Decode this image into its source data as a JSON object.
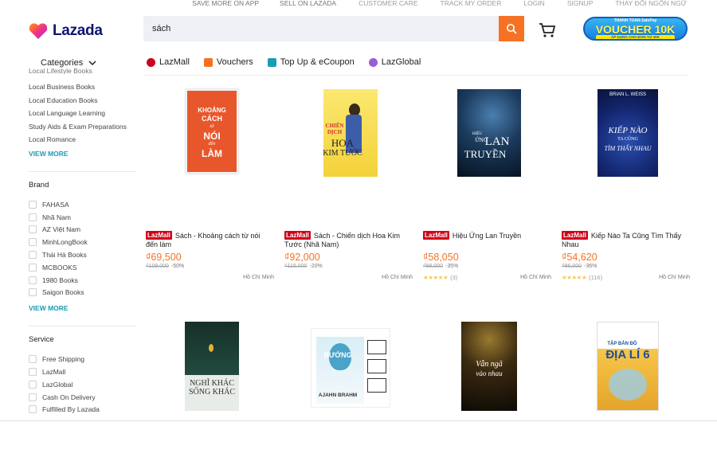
{
  "topbar": {
    "links": [
      "SAVE MORE ON APP",
      "SELL ON LAZADA",
      "CUSTOMER CARE",
      "TRACK MY ORDER",
      "LOGIN",
      "SIGNUP",
      "THAY ĐỔI NGÔN NGỮ"
    ]
  },
  "header": {
    "logo_text": "Lazada",
    "search_value": "sách",
    "voucher": {
      "top": "THANH TOÁN ZaloPay",
      "main": "VOUCHER 10K",
      "bottom": "ÁP DỤNG CHO ĐƠN TỪ 30K"
    }
  },
  "nav": {
    "categories_label": "Categories",
    "links": [
      {
        "label": "LazMall",
        "icon": "lazmall-icon",
        "color": "#d0011b"
      },
      {
        "label": "Vouchers",
        "icon": "voucher-icon",
        "color": "#f57224"
      },
      {
        "label": "Top Up & eCoupon",
        "icon": "topup-icon",
        "color": "#1a9cb7"
      },
      {
        "label": "LazGlobal",
        "icon": "lazglobal-icon",
        "color": "#9c5bd6"
      }
    ]
  },
  "sidebar": {
    "category_links": [
      "Local Lifestyle Books",
      "Local Business Books",
      "Local Education Books",
      "Local Language Learning",
      "Study Aids & Exam Preparations",
      "Local Romance"
    ],
    "view_more_1": "VIEW MORE",
    "brand_title": "Brand",
    "brands": [
      "FAHASA",
      "Nhã Nam",
      "AZ Việt Nam",
      "MinhLongBook",
      "Thái Hà Books",
      "MCBOOKS",
      "1980 Books",
      "Saigon Books"
    ],
    "view_more_2": "VIEW MORE",
    "service_title": "Service",
    "services": [
      "Free Shipping",
      "LazMall",
      "LazGlobal",
      "Cash On Delivery",
      "Fulfilled By Lazada"
    ]
  },
  "products": [
    {
      "badge": "LazMall",
      "title": "Sách - Khoảng cách từ nói đến làm",
      "price": "₫69,500",
      "old_price": "₫109,000",
      "discount": "-50%",
      "location": "Hồ Chí Minh",
      "cover_text": [
        "KHOẢNG",
        "CÁCH",
        "từ",
        "NÓI",
        "đến",
        "LÀM"
      ]
    },
    {
      "badge": "LazMall",
      "title": "Sách - Chiến dịch Hoa Kim Tước (Nhã Nam)",
      "price": "₫92,000",
      "old_price": "₫115,000",
      "discount": "-20%",
      "location": "Hồ Chí Minh",
      "cover_text": [
        "CHIẾN",
        "DỊCH",
        "HOA",
        "KIM TƯỚC"
      ]
    },
    {
      "badge": "LazMall",
      "title": "Hiệu Ứng Lan Truyền",
      "price": "₫58,050",
      "old_price": "₫89,000",
      "discount": "-35%",
      "location": "Hồ Chí Minh",
      "rating_count": "(3)",
      "cover_text": [
        "HIỆU",
        "ỨNG",
        "LAN",
        "TRUYỀN"
      ]
    },
    {
      "badge": "LazMall",
      "title": "Kiếp Nào Ta Cũng Tìm Thấy Nhau",
      "price": "₫54,620",
      "old_price": "₫86,000",
      "discount": "-36%",
      "location": "Hồ Chí Minh",
      "rating_count": "(116)",
      "cover_text": [
        "BRIAN L. WEISS",
        "KIẾP NÀO",
        "TA CŨNG",
        "TÌM THẤY NHAU"
      ]
    },
    {
      "cover_text": [
        "NGHĨ KHÁC",
        "SỐNG KHÁC"
      ]
    },
    {
      "cover_text": [
        "BƯỚNG",
        "AJAHN BRAHM"
      ]
    },
    {
      "cover_text": [
        "Vẫn ngã",
        "vào nhau"
      ]
    },
    {
      "cover_text": [
        "TẬP BẢN ĐỒ",
        "ĐỊA LÍ 6"
      ]
    }
  ],
  "colors": {
    "accent": "#f57224",
    "link": "#1a9cb7",
    "lazmall": "#d0011b",
    "brand_dark": "#0f146d"
  }
}
